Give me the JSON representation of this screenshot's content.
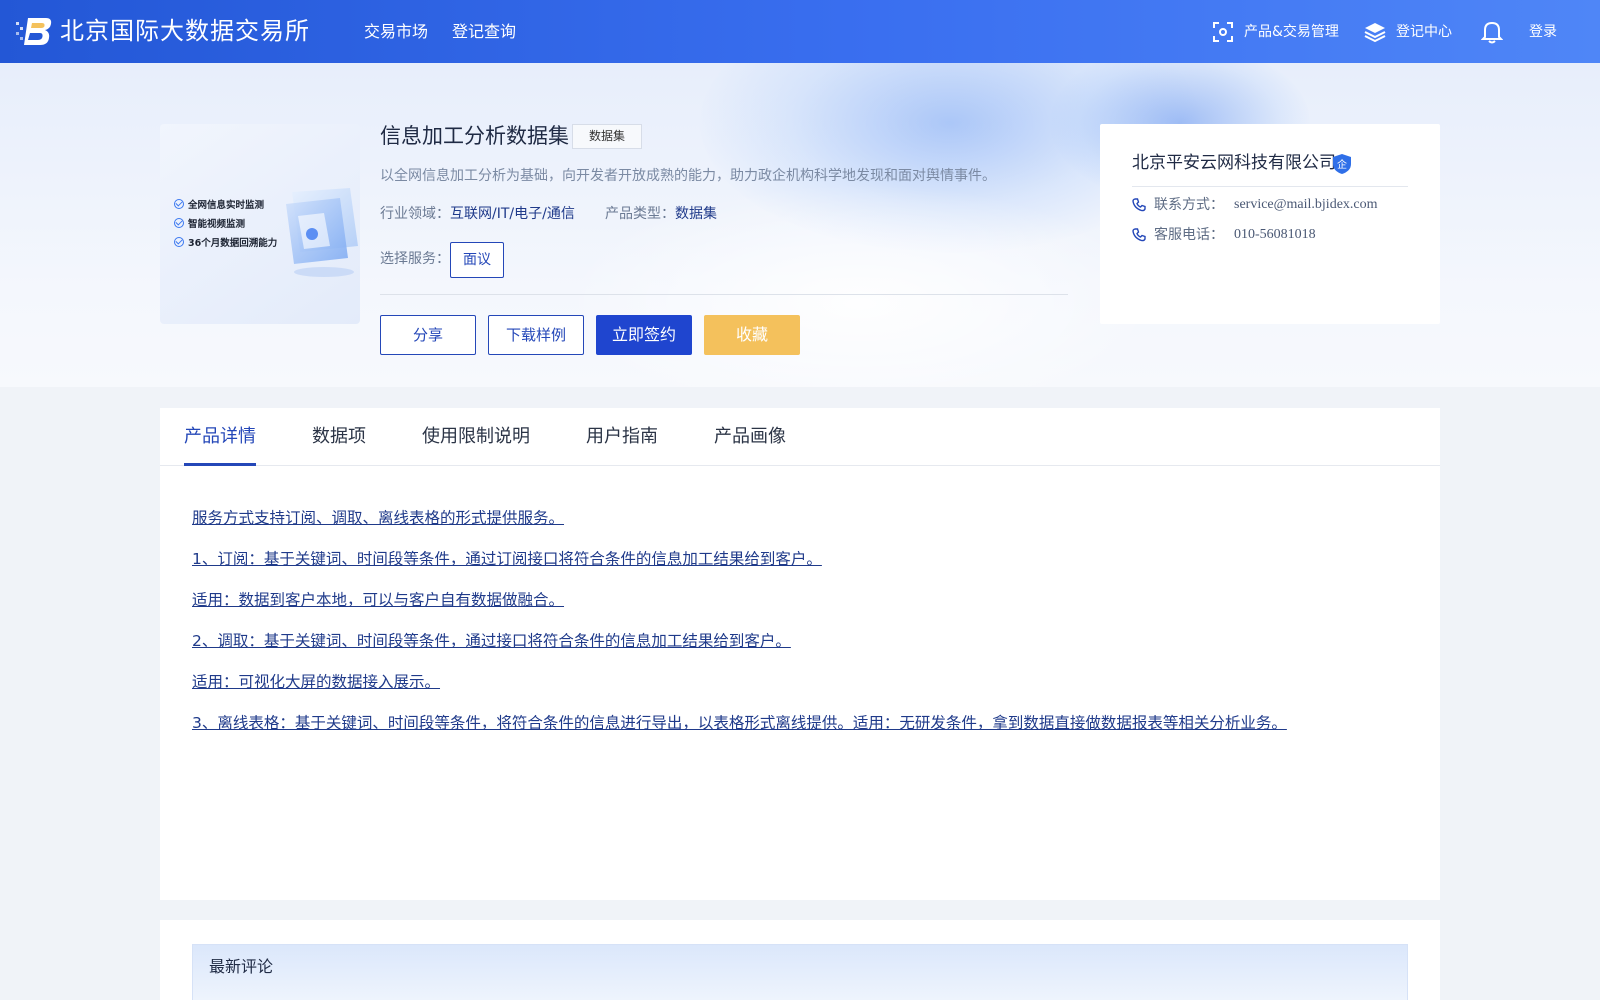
{
  "header": {
    "site_title": "北京国际大数据交易所",
    "nav": [
      "交易市场",
      "登记查询"
    ],
    "product_trade_label": "产品&交易管理",
    "register_center_label": "登记中心",
    "login_label": "登录"
  },
  "product": {
    "title": "信息加工分析数据集",
    "tag": "数据集",
    "description": "以全网信息加工分析为基础，向开发者开放成熟的能力，助力政企机构科学地发现和面对舆情事件。",
    "industry_label": "行业领域：",
    "industry_value": "互联网/IT/电子/通信",
    "type_label": "产品类型：",
    "type_value": "数据集",
    "service_label": "选择服务：",
    "service_option": "面议",
    "image_features": [
      "全网信息实时监测",
      "智能视频监测",
      "36个月数据回溯能力"
    ]
  },
  "actions": {
    "share": "分享",
    "download_sample": "下载样例",
    "sign_now": "立即签约",
    "favorite": "收藏"
  },
  "company": {
    "name": "北京平安云网科技有限公司",
    "badge": "企",
    "contact_label": "联系方式：",
    "contact_value": "service@mail.bjidex.com",
    "phone_label": "客服电话：",
    "phone_value": "010-56081018"
  },
  "tabs": [
    "产品详情",
    "数据项",
    "使用限制说明",
    "用户指南",
    "产品画像"
  ],
  "details": [
    "服务方式支持订阅、调取、离线表格的形式提供服务。",
    "1、订阅：基于关键词、时间段等条件，通过订阅接口将符合条件的信息加工结果给到客户。",
    "适用：数据到客户本地，可以与客户自有数据做融合。",
    "2、调取：基于关键词、时间段等条件，通过接口将符合条件的信息加工结果给到客户。",
    "适用：可视化大屏的数据接入展示。",
    "3、离线表格：基于关键词、时间段等条件，将符合条件的信息进行导出，以表格形式离线提供。适用：无研发条件，拿到数据直接做数据报表等相关分析业务。"
  ],
  "comments": {
    "title": "最新评论"
  },
  "colors": {
    "header_start": "#2357d6",
    "header_end": "#4f86f7",
    "primary": "#1f45cf",
    "link": "#1f3a8a",
    "favorite": "#f4c15c"
  }
}
